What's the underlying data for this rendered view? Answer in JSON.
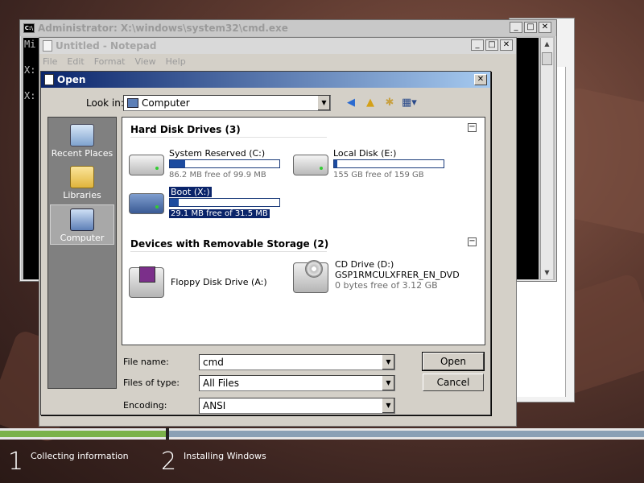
{
  "cmd": {
    "title": "Administrator: X:\\windows\\system32\\cmd.exe",
    "lines": [
      "Mi",
      "",
      "X:",
      "",
      "X:"
    ]
  },
  "notepad": {
    "title": "Untitled - Notepad",
    "menu": [
      "File",
      "Edit",
      "Format",
      "View",
      "Help"
    ]
  },
  "dialog": {
    "title": "Open",
    "look_in_label": "Look in:",
    "look_in_value": "Computer",
    "places": [
      "Recent Places",
      "Libraries",
      "Computer"
    ],
    "group_hdd": "Hard Disk Drives (3)",
    "group_removable": "Devices with Removable Storage (2)",
    "drives": [
      {
        "name": "System Reserved (C:)",
        "free": "86.2 MB free of 99.9 MB",
        "used_fraction": 0.14
      },
      {
        "name": "Local Disk (E:)",
        "free": "155 GB free of 159 GB",
        "used_fraction": 0.03
      },
      {
        "name": "Boot (X:)",
        "free": "29.1 MB free of 31.5 MB",
        "used_fraction": 0.08
      }
    ],
    "removable": [
      {
        "name": "Floppy Disk Drive (A:)"
      },
      {
        "name": "CD Drive (D:)",
        "label": "GSP1RMCULXFRER_EN_DVD",
        "free": "0 bytes free of 3.12 GB"
      }
    ],
    "file_name_label": "File name:",
    "file_name_value": "cmd",
    "files_of_type_label": "Files of type:",
    "files_of_type_value": "All Files",
    "encoding_label": "Encoding:",
    "encoding_value": "ANSI",
    "open_button": "Open",
    "cancel_button": "Cancel"
  },
  "setup": {
    "steps": [
      {
        "num": "1",
        "label": "Collecting information"
      },
      {
        "num": "2",
        "label": "Installing Windows"
      }
    ]
  },
  "colors": {
    "progress_done": "#7ab24a",
    "progress_todo": "#8aa0b5",
    "selection": "#0a246a",
    "title_active": "#0a246a"
  }
}
